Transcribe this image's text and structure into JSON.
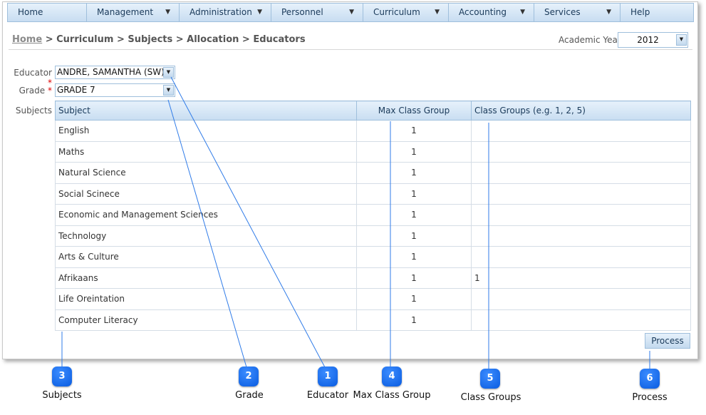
{
  "menu": [
    {
      "label": "Home",
      "dropdown": false
    },
    {
      "label": "Management",
      "dropdown": true
    },
    {
      "label": "Administration",
      "dropdown": true
    },
    {
      "label": "Personnel",
      "dropdown": true
    },
    {
      "label": "Curriculum",
      "dropdown": true
    },
    {
      "label": "Accounting",
      "dropdown": true
    },
    {
      "label": "Services",
      "dropdown": true
    },
    {
      "label": "Help",
      "dropdown": false
    }
  ],
  "breadcrumb": {
    "home": "Home",
    "rest": " > Curriculum > Subjects > Allocation > Educators"
  },
  "academic_year": {
    "label": "Academic Year",
    "value": "2012"
  },
  "form": {
    "educator_label": "Educator",
    "educator_value": "ANDRE, SAMANTHA (SW)",
    "grade_label": "Grade",
    "grade_value": "GRADE 7",
    "subjects_label": "Subjects",
    "required_mark": "*"
  },
  "table": {
    "headers": [
      "Subject",
      "Max Class Group",
      "Class Groups (e.g. 1, 2, 5)"
    ],
    "rows": [
      {
        "subject": "English",
        "max": "1",
        "groups": ""
      },
      {
        "subject": "Maths",
        "max": "1",
        "groups": ""
      },
      {
        "subject": "Natural Science",
        "max": "1",
        "groups": ""
      },
      {
        "subject": "Social Scinece",
        "max": "1",
        "groups": ""
      },
      {
        "subject": "Economic and Management Sciences",
        "max": "1",
        "groups": ""
      },
      {
        "subject": "Technology",
        "max": "1",
        "groups": ""
      },
      {
        "subject": "Arts & Culture",
        "max": "1",
        "groups": ""
      },
      {
        "subject": "Afrikaans",
        "max": "1",
        "groups": "1"
      },
      {
        "subject": "Life Oreintation",
        "max": "1",
        "groups": ""
      },
      {
        "subject": "Computer Literacy",
        "max": "1",
        "groups": ""
      }
    ]
  },
  "process_button": "Process",
  "callouts": [
    {
      "number": "3",
      "label": "Subjects"
    },
    {
      "number": "2",
      "label": "Grade"
    },
    {
      "number": "1",
      "label": "Educator"
    },
    {
      "number": "4",
      "label": "Max Class Group"
    },
    {
      "number": "5",
      "label": "Class Groups"
    },
    {
      "number": "6",
      "label": "Process"
    }
  ],
  "colors": {
    "accent": "#0a5ce0",
    "header_bg": "#c8ddf1",
    "border": "#9fbfdc",
    "required": "#dd0000"
  }
}
